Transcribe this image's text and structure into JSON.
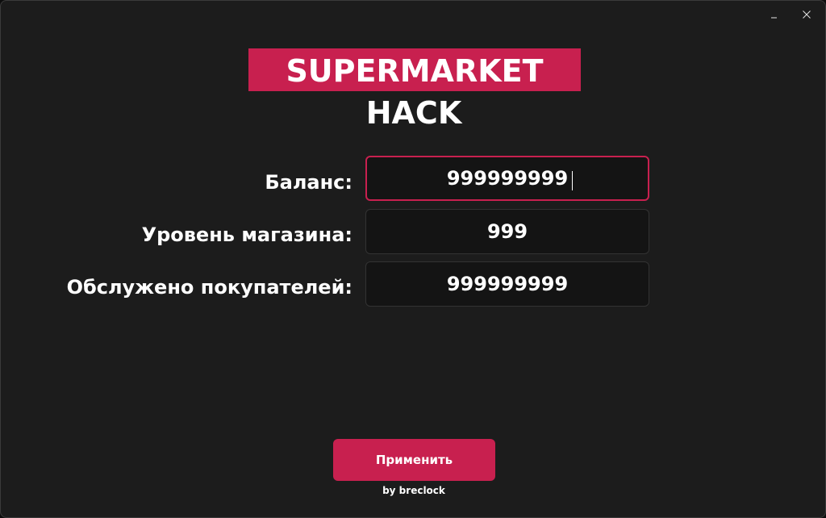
{
  "window": {
    "minimize_icon": "minimize-icon",
    "close_icon": "close-icon"
  },
  "logo": {
    "title": "SUPERMARKET",
    "subtitle": "HACK"
  },
  "fields": {
    "balance": {
      "label": "Баланс:",
      "value": "999999999"
    },
    "store_level": {
      "label": "Уровень магазина:",
      "value": "999"
    },
    "customers_served": {
      "label": "Обслужено покупателей:",
      "value": "999999999"
    }
  },
  "actions": {
    "apply_label": "Применить"
  },
  "footer": {
    "credit": "by breclock"
  },
  "colors": {
    "accent": "#c8204f",
    "background": "#1c1c1c",
    "input_background": "#141414"
  }
}
